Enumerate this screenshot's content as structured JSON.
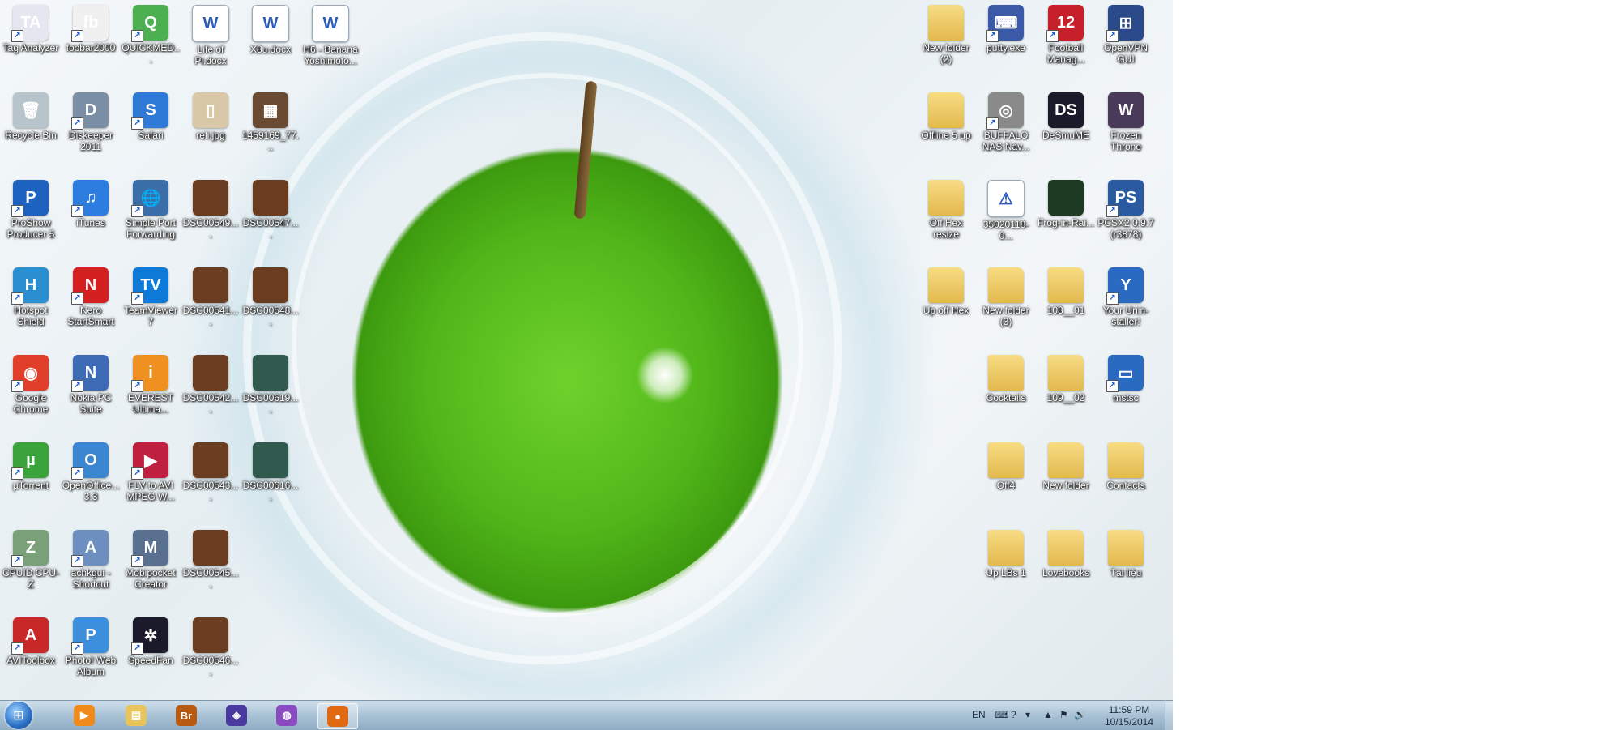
{
  "desktop": {
    "icons": [
      {
        "label": "Tag Analyzer",
        "glyph": "TA",
        "color": "#e6e6f0"
      },
      {
        "label": "foobar2000",
        "glyph": "fb",
        "color": "#f0f0f0"
      },
      {
        "label": "QUICKMED...",
        "glyph": "Q",
        "color": "#4caf50"
      },
      {
        "label": "Life of Pi.docx",
        "glyph": "W",
        "color": "#ffffff"
      },
      {
        "label": "X8u.docx",
        "glyph": "W",
        "color": "#ffffff"
      },
      {
        "label": "H6 - Banana Yoshimoto...",
        "glyph": "W",
        "color": "#ffffff"
      },
      {
        "label": "Recycle Bin",
        "glyph": "🗑",
        "color": "#b8c4cc"
      },
      {
        "label": "Diskeeper 2011",
        "glyph": "D",
        "color": "#7a8fa6"
      },
      {
        "label": "Safari",
        "glyph": "S",
        "color": "#2f7ad6"
      },
      {
        "label": "reli.jpg",
        "glyph": "▯",
        "color": "#d8c8a8"
      },
      {
        "label": "1459169_77...",
        "glyph": "▦",
        "color": "#6b4a33"
      },
      {
        "label": "ProShow Producer 5",
        "glyph": "P",
        "color": "#1e62c0"
      },
      {
        "label": "iTunes",
        "glyph": "♫",
        "color": "#2d7de0"
      },
      {
        "label": "Simple Port Forwarding",
        "glyph": "🌐",
        "color": "#3a6ea8"
      },
      {
        "label": "DSC00549....",
        "glyph": "",
        "color": "#6b3d20"
      },
      {
        "label": "DSC00547....",
        "glyph": "",
        "color": "#6b3d20"
      },
      {
        "label": "Hotspot Shield",
        "glyph": "H",
        "color": "#2a8fd0"
      },
      {
        "label": "Nero StartSmart",
        "glyph": "N",
        "color": "#d42020"
      },
      {
        "label": "TeamViewer 7",
        "glyph": "TV",
        "color": "#0e7ad8"
      },
      {
        "label": "DSC00541....",
        "glyph": "",
        "color": "#6b3d20"
      },
      {
        "label": "DSC00548....",
        "glyph": "",
        "color": "#6b3d20"
      },
      {
        "label": "Google Chrome",
        "glyph": "◉",
        "color": "#e0402a"
      },
      {
        "label": "Nokia PC Suite",
        "glyph": "N",
        "color": "#3e6bb6"
      },
      {
        "label": "EVEREST Ultima...",
        "glyph": "i",
        "color": "#f09020"
      },
      {
        "label": "DSC00542....",
        "glyph": "",
        "color": "#6b3d20"
      },
      {
        "label": "DSC00619....",
        "glyph": "",
        "color": "#2f5a4d"
      },
      {
        "label": "µTorrent",
        "glyph": "µ",
        "color": "#3aa33a"
      },
      {
        "label": "OpenOffice... 3.3",
        "glyph": "O",
        "color": "#3a86d0"
      },
      {
        "label": "FLV to AVI MPEG W...",
        "glyph": "▶",
        "color": "#c02040"
      },
      {
        "label": "DSC00543....",
        "glyph": "",
        "color": "#6b3d20"
      },
      {
        "label": "DSC00616....",
        "glyph": "",
        "color": "#2f5a4d"
      },
      {
        "label": "CPUID CPU-Z",
        "glyph": "Z",
        "color": "#7aa07a"
      },
      {
        "label": "achkgui - Shortcut",
        "glyph": "A",
        "color": "#6c8fbf"
      },
      {
        "label": "Mobipocket Creator",
        "glyph": "M",
        "color": "#5a7090"
      },
      {
        "label": "DSC00545....",
        "glyph": "",
        "color": "#6b3d20"
      },
      {
        "label": "AVIToolbox",
        "glyph": "A",
        "color": "#c82828"
      },
      {
        "label": "Photo! Web Album",
        "glyph": "P",
        "color": "#3c8fdc"
      },
      {
        "label": "SpeedFan",
        "glyph": "✲",
        "color": "#1a1a2a"
      },
      {
        "label": "DSC00546....",
        "glyph": "",
        "color": "#6b3d20"
      },
      {
        "label": "New folder (2)",
        "glyph": "",
        "color": "#e8c45c"
      },
      {
        "label": "putty.exe",
        "glyph": "⌨",
        "color": "#3a5aa8"
      },
      {
        "label": "Football Manag...",
        "glyph": "12",
        "color": "#c8202a"
      },
      {
        "label": "OpenVPN GUI",
        "glyph": "⊞",
        "color": "#2a4a8a"
      },
      {
        "label": "Offline 5 up",
        "glyph": "",
        "color": "#e8c45c"
      },
      {
        "label": "BUFFALO NAS Nav...",
        "glyph": "◎",
        "color": "#8a8a8a"
      },
      {
        "label": "DeSmuME",
        "glyph": "DS",
        "color": "#1a1a2a"
      },
      {
        "label": "Frozen Throne",
        "glyph": "W",
        "color": "#4a3a5a"
      },
      {
        "label": "Off Hex resize",
        "glyph": "",
        "color": "#e8c45c"
      },
      {
        "label": "35020118-0...",
        "glyph": "⚠",
        "color": "#ffffff"
      },
      {
        "label": "Frog-in-Rai...",
        "glyph": "",
        "color": "#1f3a22"
      },
      {
        "label": "PCSX2 0.9.7 (r3878)",
        "glyph": "PS",
        "color": "#2a5aa0"
      },
      {
        "label": "Up off Hex",
        "glyph": "",
        "color": "#e8c45c"
      },
      {
        "label": "New folder (3)",
        "glyph": "",
        "color": "#e8c45c"
      },
      {
        "label": "108__01",
        "glyph": "",
        "color": "#e8c45c"
      },
      {
        "label": "Your Unin-staller!",
        "glyph": "Y",
        "color": "#2a6ac0"
      },
      {
        "label": "Cocktails",
        "glyph": "",
        "color": "#e8c45c"
      },
      {
        "label": "109__02",
        "glyph": "",
        "color": "#e8c45c"
      },
      {
        "label": "mstsc",
        "glyph": "▭",
        "color": "#2a6ac0"
      },
      {
        "label": "Off4",
        "glyph": "",
        "color": "#e8c45c"
      },
      {
        "label": "New folder",
        "glyph": "",
        "color": "#e8c45c"
      },
      {
        "label": "Contacts",
        "glyph": "",
        "color": "#e8c45c"
      },
      {
        "label": "Up LBs 1",
        "glyph": "",
        "color": "#e8c45c"
      },
      {
        "label": "Lovebooks",
        "glyph": "",
        "color": "#e8c45c"
      },
      {
        "label": "Tài liệu",
        "glyph": "",
        "color": "#e8c45c"
      }
    ]
  },
  "taskbar": {
    "start_label": "Start",
    "pinned": [
      {
        "name": "Windows Media Player",
        "glyph": "▶",
        "color": "#f08a1a"
      },
      {
        "name": "Windows Explorer",
        "glyph": "▤",
        "color": "#e8c45c"
      },
      {
        "name": "Adobe Bridge",
        "glyph": "Br",
        "color": "#b85a10"
      },
      {
        "name": "Game",
        "glyph": "◈",
        "color": "#4a3aa0"
      },
      {
        "name": "Picasa",
        "glyph": "◍",
        "color": "#8a4ac0"
      },
      {
        "name": "Firefox",
        "glyph": "●",
        "color": "#e06a14"
      }
    ],
    "tray": {
      "language": "EN",
      "time": "11:59 PM",
      "date": "10/15/2014"
    }
  }
}
